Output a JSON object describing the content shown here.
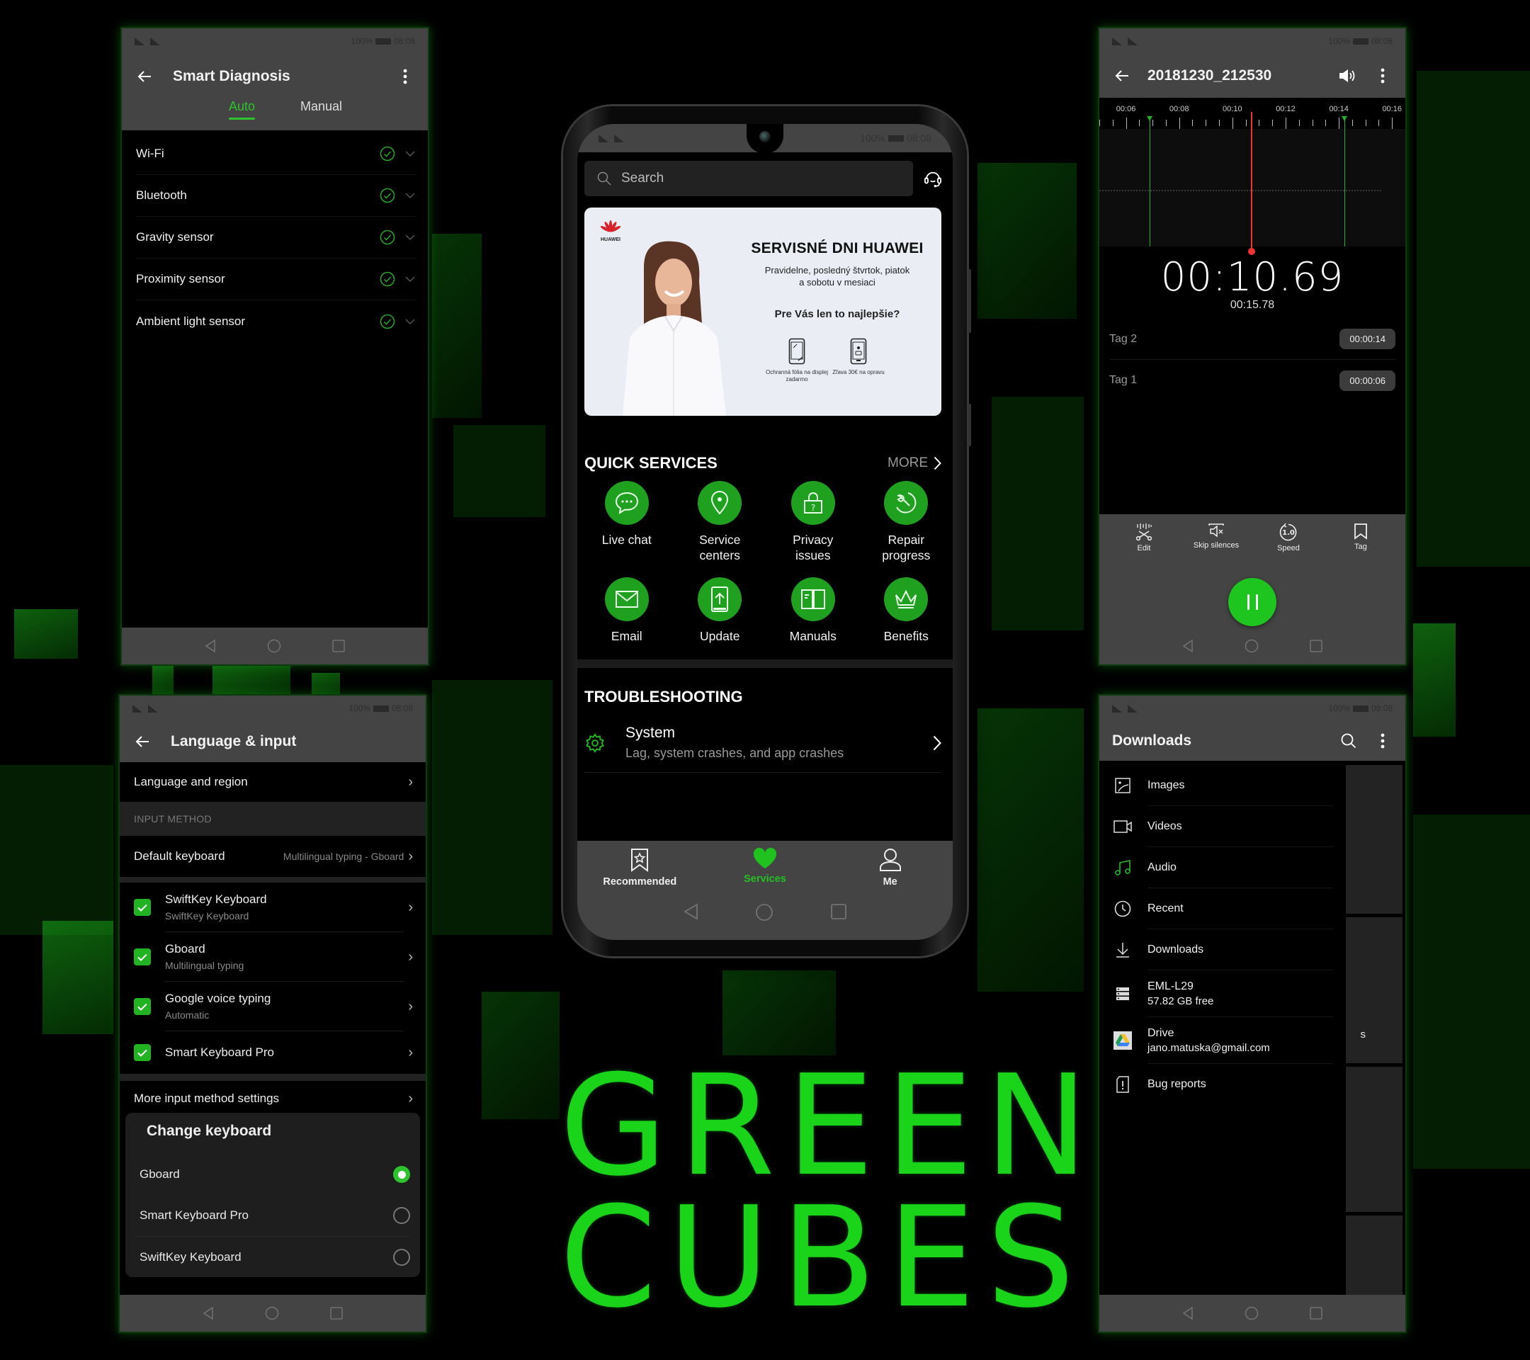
{
  "theme": {
    "accent": "#1fc21f",
    "panel_bar": "#444444",
    "background": "#000000",
    "playhead": "#ee3333"
  },
  "status_bar": {
    "battery": "100%",
    "time": "08:08"
  },
  "smart_diagnosis": {
    "title": "Smart Diagnosis",
    "tabs": [
      {
        "label": "Auto",
        "active": true
      },
      {
        "label": "Manual",
        "active": false
      }
    ],
    "items": [
      {
        "label": "Wi-Fi",
        "status": "ok"
      },
      {
        "label": "Bluetooth",
        "status": "ok"
      },
      {
        "label": "Gravity sensor",
        "status": "ok"
      },
      {
        "label": "Proximity sensor",
        "status": "ok"
      },
      {
        "label": "Ambient light sensor",
        "status": "ok"
      }
    ]
  },
  "language_input": {
    "title": "Language & input",
    "language_region": "Language and region",
    "section_header": "INPUT METHOD",
    "default_keyboard": {
      "label": "Default keyboard",
      "value": "Multilingual typing - Gboard"
    },
    "keyboards": [
      {
        "name": "SwiftKey Keyboard",
        "sub": "SwiftKey Keyboard",
        "checked": true
      },
      {
        "name": "Gboard",
        "sub": "Multilingual typing",
        "checked": true
      },
      {
        "name": "Google voice typing",
        "sub": "Automatic",
        "checked": true
      },
      {
        "name": "Smart Keyboard Pro",
        "sub": "",
        "checked": true
      }
    ],
    "more_settings": "More input method settings",
    "dialog": {
      "title": "Change keyboard",
      "options": [
        {
          "label": "Gboard",
          "selected": true
        },
        {
          "label": "Smart Keyboard Pro",
          "selected": false
        },
        {
          "label": "SwiftKey Keyboard",
          "selected": false
        }
      ]
    }
  },
  "support_app": {
    "search_placeholder": "Search",
    "banner": {
      "brand": "HUAWEI",
      "title": "SERVISNÉ DNI HUAWEI",
      "subtitle": "Pravidelne, posledný štvrtok, piatok a sobotu v mesiaci",
      "question": "Pre Vás len to najlepšie?",
      "offers": [
        "Ochranná fólia na displej zadarmo",
        "Zľava 30€ na opravu"
      ]
    },
    "quick_services": {
      "title": "QUICK SERVICES",
      "more": "MORE",
      "items": [
        {
          "label": "Live chat",
          "icon": "chat-bubble-icon"
        },
        {
          "label": "Service\ncenters",
          "icon": "location-pin-icon"
        },
        {
          "label": "Privacy\nissues",
          "icon": "lock-question-icon"
        },
        {
          "label": "Repair\nprogress",
          "icon": "wrench-progress-icon"
        },
        {
          "label": "Email",
          "icon": "envelope-icon"
        },
        {
          "label": "Update",
          "icon": "phone-update-icon"
        },
        {
          "label": "Manuals",
          "icon": "book-icon"
        },
        {
          "label": "Benefits",
          "icon": "crown-icon"
        }
      ]
    },
    "troubleshooting": {
      "title": "TROUBLESHOOTING",
      "item": {
        "title": "System",
        "subtitle": "Lag, system crashes, and app crashes"
      }
    },
    "bottom_tabs": [
      {
        "label": "Recommended",
        "active": false
      },
      {
        "label": "Services",
        "active": true
      },
      {
        "label": "Me",
        "active": false
      }
    ]
  },
  "recorder": {
    "title": "20181230_212530",
    "ruler_labels": [
      "00:06",
      "00:08",
      "00:10",
      "00:12",
      "00:14",
      "00:16"
    ],
    "ruler_start_s": 5.0,
    "ruler_end_s": 16.5,
    "tag_markers_s": [
      6.9,
      14.2
    ],
    "playhead_s": 10.69,
    "current_time": "00:10.69",
    "total_time": "00:15.78",
    "tags": [
      {
        "label": "Tag 2",
        "time": "00:00:14"
      },
      {
        "label": "Tag 1",
        "time": "00:00:06"
      }
    ],
    "tools": [
      {
        "label": "Edit",
        "icon": "scissors-icon"
      },
      {
        "label": "Skip silences",
        "icon": "mute-icon"
      },
      {
        "label": "Speed",
        "icon": "speed-icon",
        "value": "1.0"
      },
      {
        "label": "Tag",
        "icon": "bookmark-icon"
      }
    ]
  },
  "downloads": {
    "title": "Downloads",
    "items": [
      {
        "name": "Images",
        "sub": "",
        "icon": "image-icon"
      },
      {
        "name": "Videos",
        "sub": "",
        "icon": "video-icon"
      },
      {
        "name": "Audio",
        "sub": "",
        "icon": "music-note-icon"
      },
      {
        "name": "Recent",
        "sub": "",
        "icon": "clock-icon"
      },
      {
        "name": "Downloads",
        "sub": "",
        "icon": "download-icon"
      },
      {
        "name": "EML-L29",
        "sub": "57.82 GB free",
        "icon": "storage-icon"
      },
      {
        "name": "Drive",
        "sub": "jano.matuska@gmail.com",
        "icon": "google-drive-icon"
      },
      {
        "name": "Bug reports",
        "sub": "",
        "icon": "bug-report-icon"
      }
    ],
    "peek_text": "s"
  },
  "brand_text": {
    "line1": "GREEN",
    "line2": "CUBES"
  }
}
